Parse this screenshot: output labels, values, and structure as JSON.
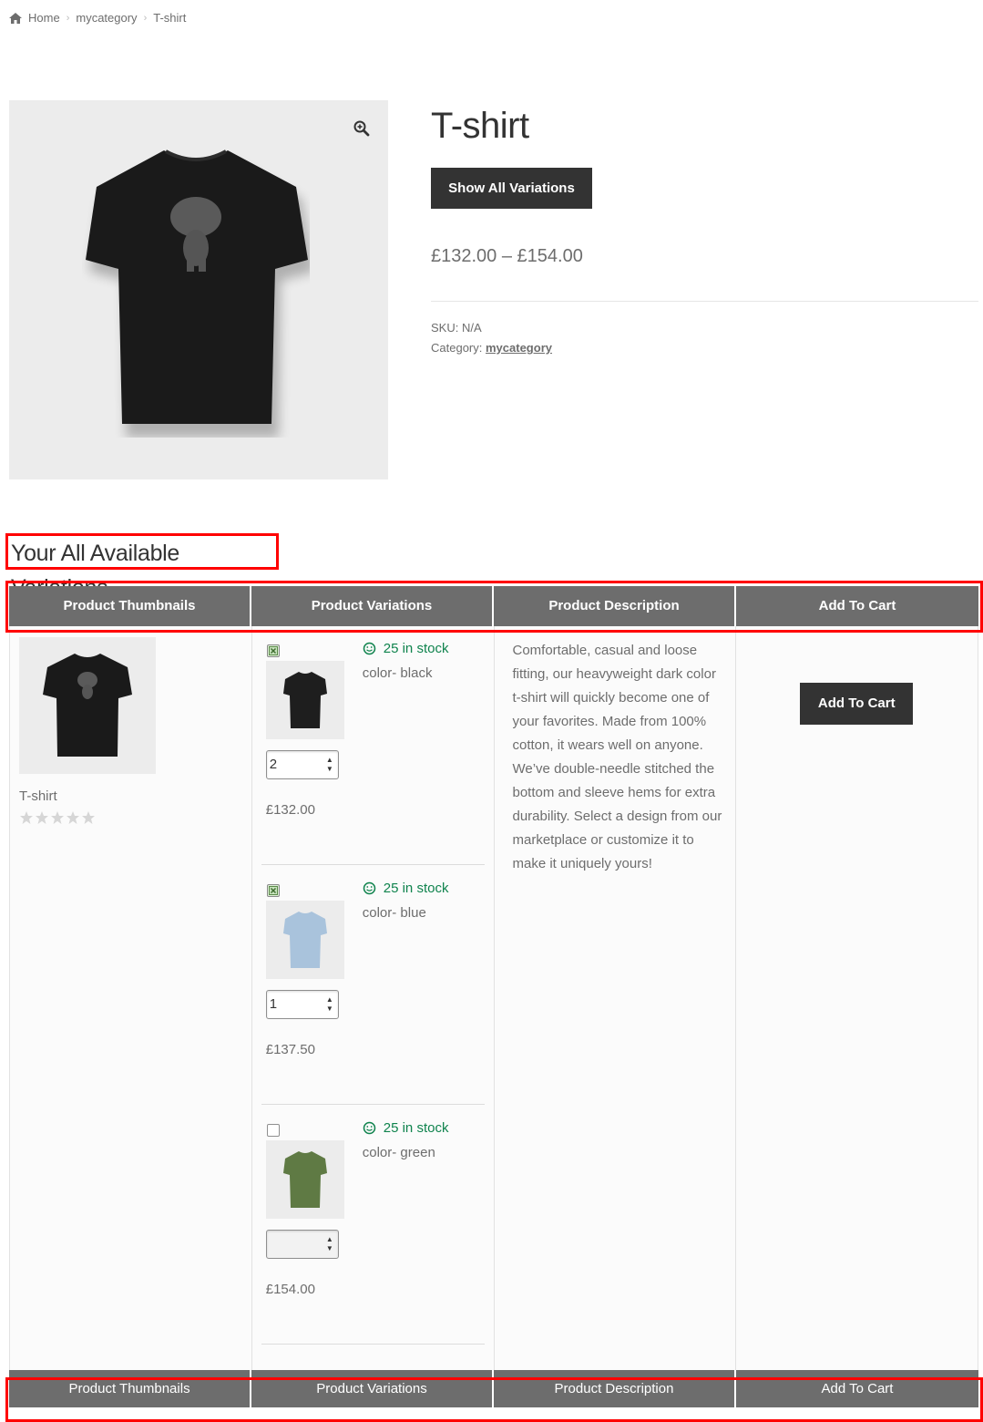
{
  "breadcrumb": {
    "home": "Home",
    "category": "mycategory",
    "current": "T-shirt",
    "separator": "›"
  },
  "product": {
    "title": "T-shirt",
    "show_all_button": "Show All Variations",
    "price_range": "£132.00 – £154.00",
    "sku_label": "SKU:",
    "sku_value": "N/A",
    "category_label": "Category:",
    "category_value": "mycategory",
    "image_icon": "tshirt-black-icon",
    "zoom_icon": "zoom-in-icon"
  },
  "variations_section": {
    "heading": "Your All Available Variations",
    "columns": [
      "Product Thumbnails",
      "Product Variations",
      "Product Description",
      "Add To Cart"
    ],
    "thumbnail": {
      "title": "T-shirt",
      "rating": 0,
      "rating_max": 5
    },
    "items": [
      {
        "checked": true,
        "stock": "25 in stock",
        "color": "color- black",
        "quantity": "2",
        "price": "£132.00",
        "shirt_color": "#1e1e1e"
      },
      {
        "checked": true,
        "stock": "25 in stock",
        "color": "color- blue",
        "quantity": "1",
        "price": "£137.50",
        "shirt_color": "#a9c3dc"
      },
      {
        "checked": false,
        "stock": "25 in stock",
        "color": "color- green",
        "quantity": "",
        "price": "£154.00",
        "shirt_color": "#5f7a44"
      }
    ],
    "description": "Comfortable, casual and loose fitting, our heavyweight dark color t-shirt will quickly become one of your favorites. Made from 100% cotton, it wears well on anyone. We’ve double-needle stitched the bottom and sleeve hems for extra durability. Select a design from our marketplace or customize it to make it uniquely yours!",
    "add_to_cart": "Add To Cart"
  },
  "colors": {
    "header_bg": "#6d6d6d",
    "button_bg": "#333333",
    "stock_green": "#0f834d",
    "highlight_red": "#ff0000"
  }
}
